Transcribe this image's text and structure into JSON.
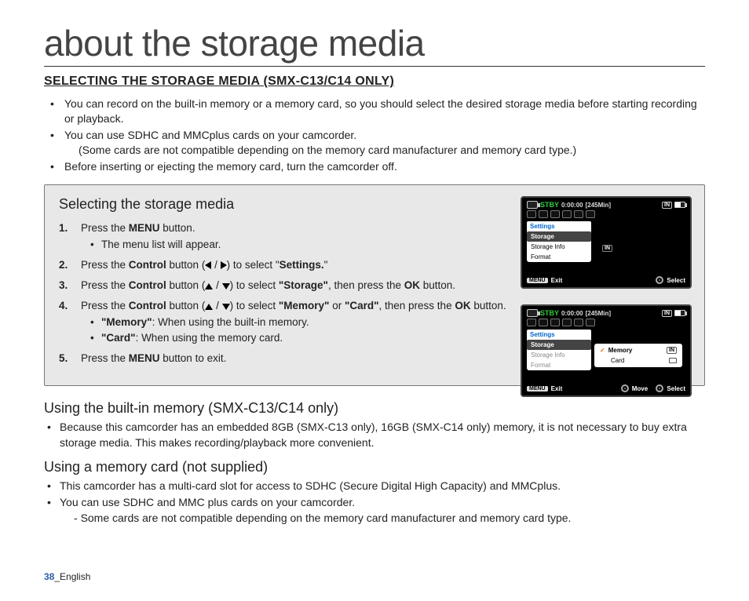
{
  "page": {
    "title": "about the storage media",
    "section_heading": "SELECTING THE STORAGE MEDIA (SMX-C13/C14 ONLY)",
    "intro_bullets": [
      "You can record on the built-in memory or a memory card, so you should select the desired storage media before starting recording or playback.",
      "You can use SDHC and MMCplus cards on your camcorder.",
      "Before inserting or ejecting the memory card, turn the camcorder off."
    ],
    "intro_bullet2_sub": "(Some cards are not compatible depending on the memory card manufacturer and memory card type.)"
  },
  "panel": {
    "heading": "Selecting the storage media",
    "step1": {
      "pre": "Press the ",
      "b": "MENU",
      "post": " button.",
      "sub": "The menu list will appear."
    },
    "step2": {
      "pre": "Press the ",
      "b": "Control",
      "mid": " button (",
      "post": ") to select \"",
      "b2": "Settings.",
      "end": "\""
    },
    "step3": {
      "pre": "Press the ",
      "b": "Control",
      "mid": " button (",
      "post": ") to select ",
      "b2": "\"Storage\"",
      "end2": ", then press the ",
      "b3": "OK",
      "end3": " button."
    },
    "step4": {
      "pre": "Press the ",
      "b": "Control",
      "mid": " button (",
      "post": ") to select  ",
      "b2": "\"Memory\"",
      "or": " or ",
      "b3": "\"Card\"",
      "end": ", then press the ",
      "b4": "OK",
      "end2": " button.",
      "sub1_b": "\"Memory\"",
      "sub1_t": ": When using the built-in memory.",
      "sub2_b": "\"Card\"",
      "sub2_t": ": When using the memory card."
    },
    "step5": {
      "pre": "Press the ",
      "b": "MENU",
      "post": " button to exit."
    }
  },
  "lcd": {
    "stby": "STBY",
    "time": "0:00:00",
    "remain": "[245Min]",
    "in": "IN",
    "settings": "Settings",
    "storage": "Storage",
    "storage_info": "Storage Info",
    "format": "Format",
    "memory": "Memory",
    "card": "Card",
    "menu": "MENU",
    "exit": "Exit",
    "select": "Select",
    "move": "Move"
  },
  "builtin": {
    "heading": "Using the built-in memory (SMX-C13/C14 only)",
    "b1": "Because this camcorder has an embedded 8GB (SMX-C13 only), 16GB (SMX-C14 only) memory, it is not necessary to buy extra storage media. This makes recording/playback more convenient."
  },
  "memcard": {
    "heading": "Using a memory card (not supplied)",
    "b1": "This camcorder has a multi-card slot for access to SDHC (Secure Digital High Capacity) and MMCplus.",
    "b2": "You can use SDHC and MMC plus cards on your camcorder.",
    "b2_sub": "Some cards are not compatible depending on the memory card manufacturer and memory card type."
  },
  "footer": {
    "page": "38",
    "lang": "_English"
  }
}
